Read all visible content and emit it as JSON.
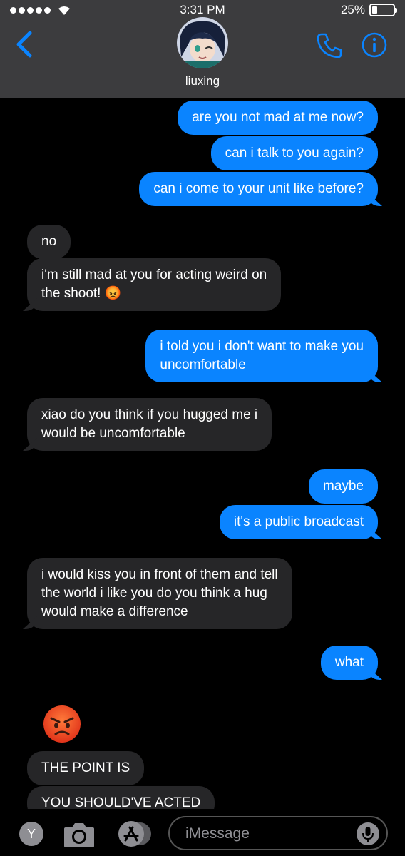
{
  "status_bar": {
    "time": "3:31 PM",
    "battery_percent": "25%",
    "battery_level": 0.25,
    "signal_bars": 5
  },
  "header": {
    "contact_name": "liuxing",
    "back_icon": "chevron-left-icon",
    "call_icon": "phone-icon",
    "info_icon": "info-icon"
  },
  "messages": [
    {
      "from": "me",
      "text": "are you not mad at me now?"
    },
    {
      "from": "me",
      "text": "can i talk to you again?"
    },
    {
      "from": "me",
      "text": "can i come to your unit like before?"
    },
    {
      "from": "them",
      "text": "no"
    },
    {
      "from": "them",
      "text": "i'm still mad at you for acting weird on\nthe shoot! 😡"
    },
    {
      "from": "me",
      "text": "i told you i don't want to make you\nuncomfortable"
    },
    {
      "from": "them",
      "text": "xiao do you think if you hugged me i\nwould be uncomfortable"
    },
    {
      "from": "me",
      "text": "maybe"
    },
    {
      "from": "me",
      "text": "it's a public broadcast"
    },
    {
      "from": "them",
      "text": "i would kiss you in front of them and tell\nthe world i like you do you think a hug\nwould make a difference"
    },
    {
      "from": "me",
      "text": "what"
    },
    {
      "from": "them",
      "text": "😡",
      "type": "emoji"
    },
    {
      "from": "them",
      "text": "THE POINT IS"
    },
    {
      "from": "them",
      "text": "YOU SHOULD'VE ACTED"
    }
  ],
  "input_bar": {
    "placeholder": "iMessage",
    "app_icon_letter": "Y",
    "camera_icon": "camera-icon",
    "appstore_icon": "app-store-icon",
    "mic_icon": "microphone-icon"
  },
  "colors": {
    "outgoing_bubble": "#0a84ff",
    "incoming_bubble": "#262628",
    "header_bg": "#3c3c3e",
    "background": "#000000"
  }
}
